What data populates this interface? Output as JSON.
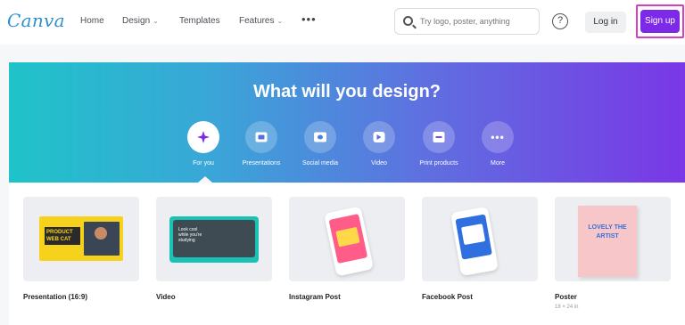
{
  "header": {
    "logo": "Canva",
    "nav": [
      {
        "label": "Home"
      },
      {
        "label": "Design",
        "caret": "⌄"
      },
      {
        "label": "Templates"
      },
      {
        "label": "Features",
        "caret": "⌄"
      }
    ],
    "more": "•••",
    "search_placeholder": "Try logo, poster, anything",
    "help_icon": "?",
    "login": "Log in",
    "signup": "Sign up"
  },
  "hero": {
    "title": "What will you design?",
    "categories": [
      {
        "label": "For you",
        "icon": "sparkle-icon"
      },
      {
        "label": "Presentations",
        "icon": "presentation-icon"
      },
      {
        "label": "Social media",
        "icon": "social-media-icon"
      },
      {
        "label": "Video",
        "icon": "video-icon"
      },
      {
        "label": "Print products",
        "icon": "print-icon"
      },
      {
        "label": "More",
        "icon": "more-icon"
      }
    ],
    "more_glyph": "•••"
  },
  "templates": [
    {
      "name": "Presentation (16:9)",
      "thumb_text": "PRODUCT WEB CAT"
    },
    {
      "name": "Video",
      "thumb_text": "Look cool while you're studying"
    },
    {
      "name": "Instagram Post"
    },
    {
      "name": "Facebook Post"
    },
    {
      "name": "Poster",
      "sub": "18 × 24 in",
      "thumb_text": "LOVELY THE ARTIST"
    }
  ],
  "colors": {
    "brand_purple": "#7d2ae8",
    "signup_highlight": "#d63fbf",
    "logo_blue": "#2f8fcf",
    "hero_gradient_start": "#1fc3c9",
    "hero_gradient_end": "#7a37e6"
  }
}
